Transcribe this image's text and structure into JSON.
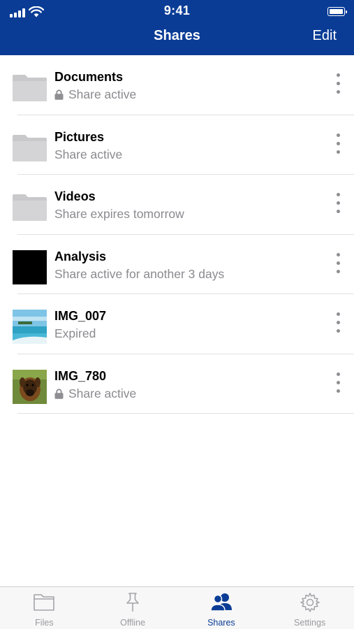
{
  "status_bar": {
    "time": "9:41"
  },
  "nav": {
    "title": "Shares",
    "edit_label": "Edit"
  },
  "items": [
    {
      "title": "Documents",
      "subtitle": "Share active",
      "locked": true,
      "thumb": "folder"
    },
    {
      "title": "Pictures",
      "subtitle": "Share active",
      "locked": false,
      "thumb": "folder"
    },
    {
      "title": "Videos",
      "subtitle": "Share expires tomorrow",
      "locked": false,
      "thumb": "folder"
    },
    {
      "title": "Analysis",
      "subtitle": "Share active for another 3 days",
      "locked": false,
      "thumb": "black-image"
    },
    {
      "title": "IMG_007",
      "subtitle": "Expired",
      "locked": false,
      "thumb": "beach-photo"
    },
    {
      "title": "IMG_780",
      "subtitle": "Share active",
      "locked": true,
      "thumb": "dog-photo"
    }
  ],
  "tabs": [
    {
      "label": "Files",
      "icon": "folder-icon",
      "active": false
    },
    {
      "label": "Offline",
      "icon": "pin-icon",
      "active": false
    },
    {
      "label": "Shares",
      "icon": "people-icon",
      "active": true
    },
    {
      "label": "Settings",
      "icon": "gear-icon",
      "active": false
    }
  ],
  "colors": {
    "header": "#0a3c96",
    "accent": "#0a3c96",
    "secondary_text": "#8a8a8f"
  }
}
